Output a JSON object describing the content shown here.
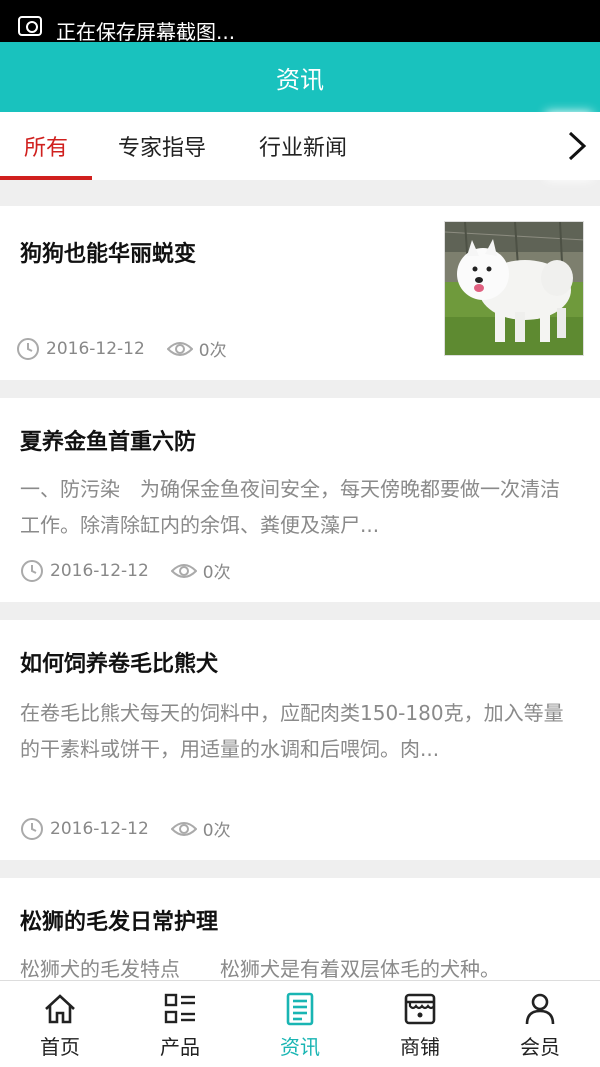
{
  "statusbar": {
    "message": "正在保存屏幕截图..."
  },
  "header": {
    "title": "资讯"
  },
  "tabs": [
    {
      "label": "所有",
      "active": true
    },
    {
      "label": "专家指导",
      "active": false
    },
    {
      "label": "行业新闻",
      "active": false
    }
  ],
  "articles": [
    {
      "title": "狗狗也能华丽蜕变",
      "date": "2016-12-12",
      "views": "0次",
      "has_image": true
    },
    {
      "title": "夏养金鱼首重六防",
      "desc": " 一、防污染　为确保金鱼夜间安全，每天傍晚都要做一次清洁工作。除清除缸内的余饵、粪便及藻尸...",
      "date": "2016-12-12",
      "views": "0次"
    },
    {
      "title": "如何饲养卷毛比熊犬",
      "desc": "在卷毛比熊犬每天的饲料中，应配肉类150-180克，加入等量的干素料或饼干，用适量的水调和后喂饲。肉...",
      "date": "2016-12-12",
      "views": "0次"
    },
    {
      "title": "松狮的毛发日常护理",
      "desc": "松狮犬的毛发特点　　松狮犬是有着双层体毛的犬种。"
    }
  ],
  "bottom_nav": [
    {
      "label": "首页",
      "icon": "home-icon",
      "active": false
    },
    {
      "label": "产品",
      "icon": "grid-list-icon",
      "active": false
    },
    {
      "label": "资讯",
      "icon": "news-icon",
      "active": true
    },
    {
      "label": "商铺",
      "icon": "shop-icon",
      "active": false
    },
    {
      "label": "会员",
      "icon": "user-icon",
      "active": false
    }
  ],
  "colors": {
    "header": "#19c2be",
    "active_tab": "#d0201e",
    "active_nav": "#19b5b3"
  }
}
